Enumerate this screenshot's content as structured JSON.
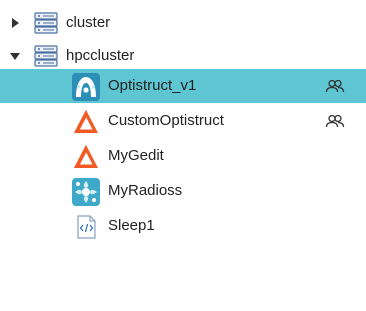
{
  "tree": {
    "clusters": [
      {
        "label": "cluster",
        "expanded": false
      },
      {
        "label": "hpccluster",
        "expanded": true
      }
    ],
    "apps": [
      {
        "label": "Optistruct_v1",
        "icon": "optistruct-icon",
        "shared": true,
        "selected": true
      },
      {
        "label": "CustomOptistruct",
        "icon": "altair-logo-icon",
        "shared": true,
        "selected": false
      },
      {
        "label": "MyGedit",
        "icon": "altair-logo-icon",
        "shared": false,
        "selected": false
      },
      {
        "label": "MyRadioss",
        "icon": "radioss-icon",
        "shared": false,
        "selected": false
      },
      {
        "label": "Sleep1",
        "icon": "script-file-icon",
        "shared": false,
        "selected": false
      }
    ]
  },
  "colors": {
    "selection": "#5ec6d2",
    "altair_orange": "#f15a22",
    "server_blue": "#4a6fa5"
  }
}
